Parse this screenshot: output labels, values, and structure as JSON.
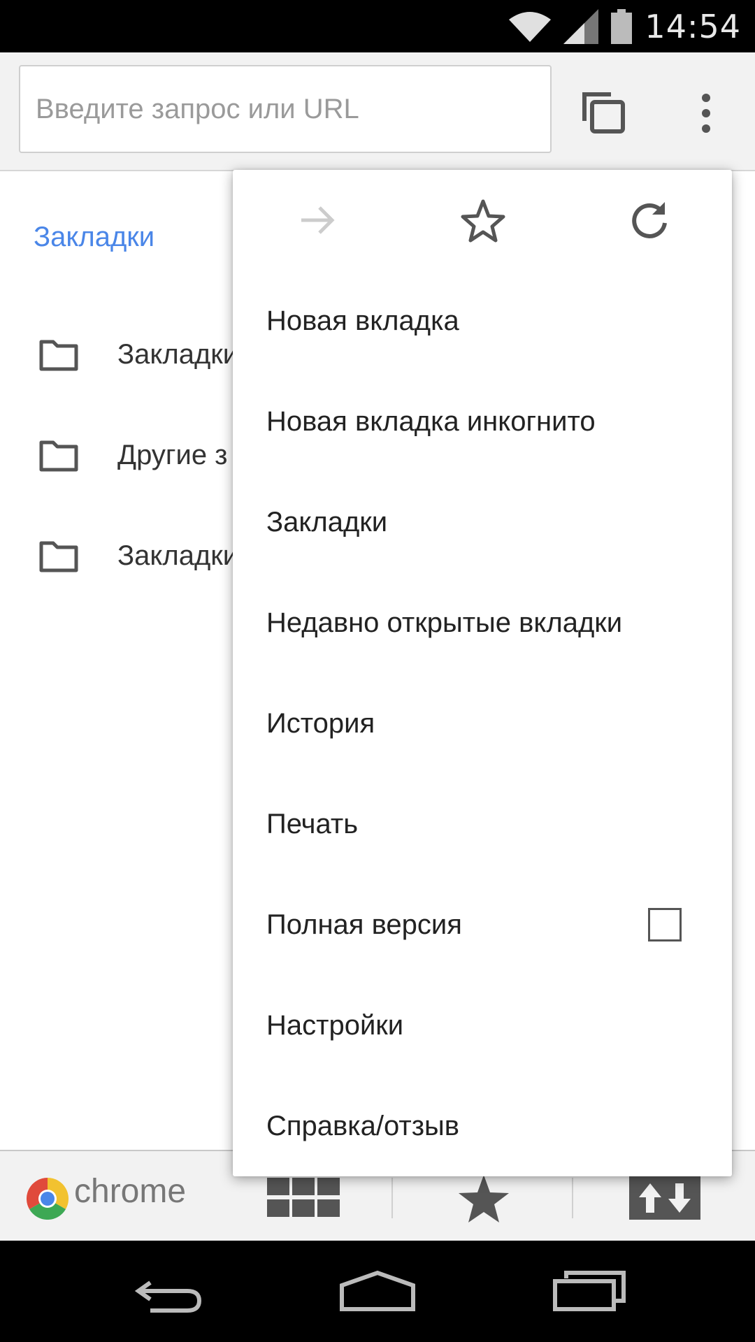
{
  "statusbar": {
    "time": "14:54"
  },
  "toolbar": {
    "search_placeholder": "Введите запрос или URL"
  },
  "bookmarks_page": {
    "heading": "Закладки",
    "folders": [
      {
        "label": "Закладки"
      },
      {
        "label": "Другие з"
      },
      {
        "label": "Закладки"
      }
    ]
  },
  "menu": {
    "items": [
      {
        "label": "Новая вкладка"
      },
      {
        "label": "Новая вкладка инкогнито"
      },
      {
        "label": "Закладки"
      },
      {
        "label": "Недавно открытые вкладки"
      },
      {
        "label": "История"
      },
      {
        "label": "Печать"
      },
      {
        "label": "Полная версия"
      },
      {
        "label": "Настройки"
      },
      {
        "label": "Справка/отзыв"
      }
    ],
    "full_version_checked": false
  },
  "bottombar": {
    "brand": "chrome"
  },
  "colors": {
    "accent": "#4a86e8",
    "icon_dark": "#555555",
    "icon_disabled": "#cccccc"
  }
}
